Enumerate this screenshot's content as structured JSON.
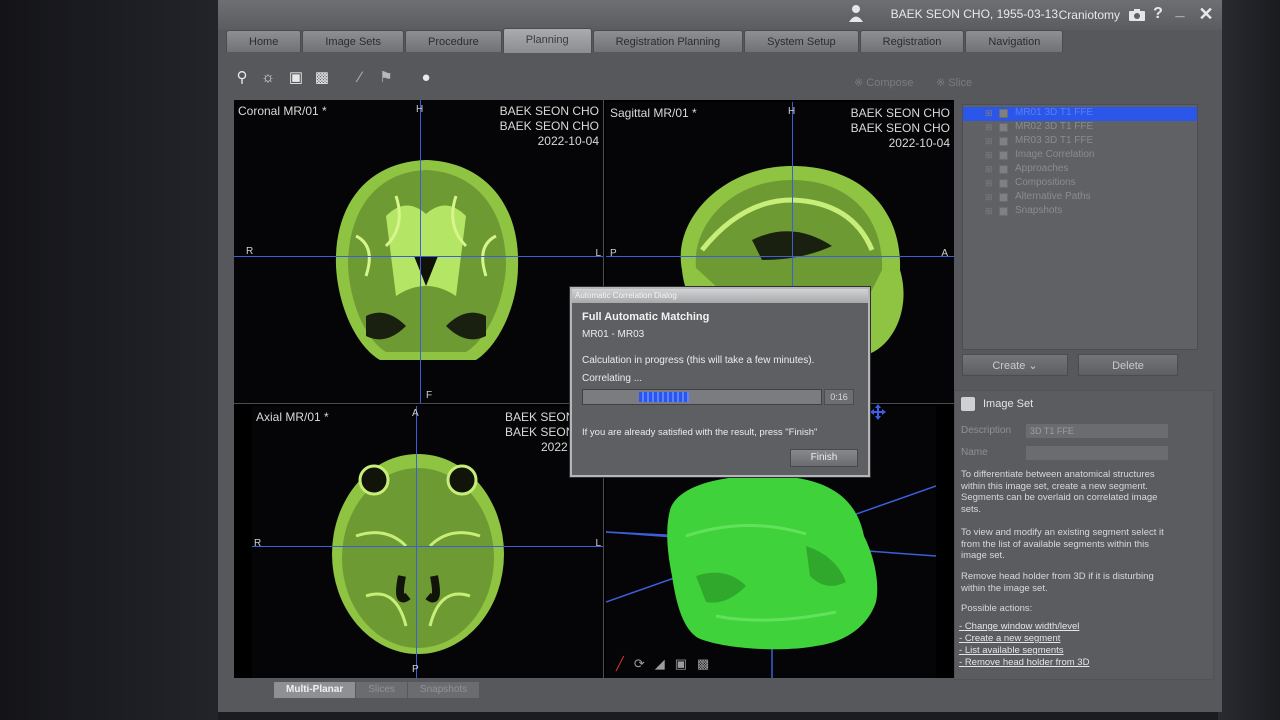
{
  "titlebar": {
    "patient": "BAEK SEON CHO, 1955-03-13",
    "procedure": "Craniotomy",
    "buttons": {
      "camera": "camera-icon",
      "help": "?",
      "minimize": "_",
      "close": "✕"
    }
  },
  "nav_tabs": [
    "Home",
    "Image Sets",
    "Procedure",
    "Planning",
    "Registration Planning",
    "System Setup",
    "Registration",
    "Navigation"
  ],
  "active_tab": "Planning",
  "toolbar": {
    "icons": [
      "zoom-icon",
      "brightness-icon",
      "camera-icon",
      "stamp-icon",
      "ruler-icon",
      "flag-icon",
      "sphere-icon"
    ],
    "compose_label": "Compose",
    "slice_label": "Slice"
  },
  "viewports": {
    "coronal": {
      "label": "Coronal MR/01 *",
      "name1": "BAEK SEON CHO",
      "name2": "BAEK SEON CHO",
      "date": "2022-10-04",
      "top": "H",
      "left": "R",
      "right": "L",
      "bottom": "F"
    },
    "sagittal": {
      "label": "Sagittal MR/01 *",
      "name1": "BAEK SEON CHO",
      "name2": "BAEK SEON CHO",
      "date": "2022-10-04",
      "top": "H",
      "left": "P",
      "right": "A"
    },
    "axial": {
      "label": "Axial MR/01 *",
      "name1": "BAEK SEON",
      "name2": "BAEK SEON",
      "date": "2022",
      "top": "A",
      "left": "R",
      "right": "L",
      "bottom": "P"
    }
  },
  "bottom_tabs": [
    "Multi-Planar",
    "Slices",
    "Snapshots"
  ],
  "active_bottom_tab": "Multi-Planar",
  "tree": {
    "items": [
      {
        "label": "MR01 3D T1 FFE",
        "selected": true
      },
      {
        "label": "MR02 3D T1 FFE",
        "selected": false
      },
      {
        "label": "MR03 3D T1 FFE",
        "selected": false
      },
      {
        "label": "Image Correlation",
        "selected": false
      },
      {
        "label": "Approaches",
        "selected": false
      },
      {
        "label": "Compositions",
        "selected": false
      },
      {
        "label": "Alternative Paths",
        "selected": false
      },
      {
        "label": "Snapshots",
        "selected": false
      }
    ]
  },
  "panel_buttons": {
    "create": "Create",
    "delete": "Delete"
  },
  "image_set": {
    "title": "Image Set",
    "description_label": "Description",
    "description_value": "3D T1 FFE",
    "name_label": "Name",
    "help1": "To differentiate between anatomical structures within this image set, create a new segment. Segments can be overlaid on correlated image sets.",
    "help2": "To view and modify an existing segment select it from the list of available segments within this image set.",
    "help3": "Remove head holder from 3D if it is disturbing within the image set.",
    "possible_actions": "Possible actions:",
    "actions": [
      "Change window width/level",
      "Create a new segment",
      "List available segments",
      "Remove head holder from 3D"
    ]
  },
  "dialog": {
    "title": "Automatic Correlation Dialog",
    "heading": "Full Automatic Matching",
    "pair": "MR01 - MR03",
    "status": "Calculation in progress (this will take a few minutes).",
    "stage": "Correlating ...",
    "progress": 0.3,
    "elapsed": "0:16",
    "hint": "If you are already satisfied with the result, press \"Finish\"",
    "finish_label": "Finish"
  },
  "colors": {
    "accent": "#2a56ea",
    "crosshair": "#3b5fd9",
    "brain": "#9ad64a",
    "render3d": "#3fd23a"
  }
}
